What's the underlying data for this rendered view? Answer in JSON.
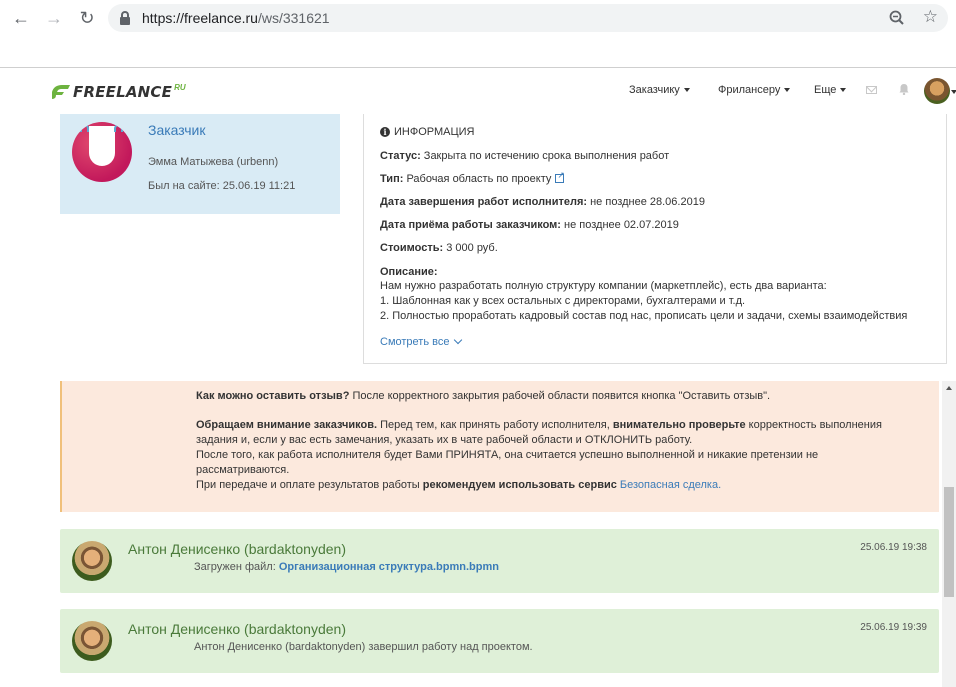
{
  "browser": {
    "url_host": "https://freelance.ru",
    "url_path": "/ws/331621"
  },
  "header": {
    "logo_text": "FREELANCE",
    "logo_suffix": "RU",
    "nav": [
      {
        "label": "Заказчику"
      },
      {
        "label": "Фрилансеру"
      },
      {
        "label": "Еще"
      }
    ]
  },
  "customer": {
    "role": "Заказчик",
    "name": "Эмма Матыжева (urbenn)",
    "last_seen": "Был на сайте: 25.06.19 11:21"
  },
  "info": {
    "title": "ИНФОРМАЦИЯ",
    "status_label": "Статус:",
    "status_value": "Закрыта по истечению срока выполнения работ",
    "type_label": "Тип:",
    "type_value": "Рабочая область по проекту",
    "deadline_label": "Дата завершения работ исполнителя:",
    "deadline_value": "не позднее 28.06.2019",
    "acceptance_label": "Дата приёма работы заказчиком:",
    "acceptance_value": "не позднее 02.07.2019",
    "cost_label": "Стоимость:",
    "cost_value": "3 000 руб.",
    "description_label": "Описание:",
    "description_lines": [
      "Нам нужно разработать полную структуру компании (маркетплейс), есть два варианта:",
      "1. Шаблонная как у всех остальных с директорами, бухгалтерами и т.д.",
      "2. Полностью проработать кадровый состав под нас, прописать цели и задачи, схемы взаимодействия"
    ],
    "see_all": "Смотреть все"
  },
  "notice": {
    "l1_bold": "Как можно оставить отзыв?",
    "l1_text": " После корректного закрытия рабочей области появится кнопка \"Оставить отзыв\".",
    "l2_bold": "Обращаем внимание заказчиков.",
    "l2_text": " Перед тем, как принять работу исполнителя, ",
    "l2_bold2": "внимательно проверьте",
    "l2_text2": " корректность выполнения",
    "l3": "задания и, если у вас есть замечания, указать их в чате рабочей области и ОТКЛОНИТЬ работу.",
    "l4": "После того, как работа исполнителя будет Вами ПРИНЯТА, она считается успешно выполненной и никакие претензии не",
    "l5": "рассматриваются.",
    "l6_text": "При передаче и оплате результатов работы ",
    "l6_bold": "рекомендуем использовать сервис",
    "l6_link": "Безопасная сделка."
  },
  "messages": [
    {
      "author": "Антон Денисенко (bardaktonyden)",
      "time": "25.06.19 19:38",
      "prefix": "Загружен файл: ",
      "link": "Организационная структура.bpmn.bpmn"
    },
    {
      "author": "Антон Денисенко (bardaktonyden)",
      "time": "25.06.19 19:39",
      "text": "Антон Денисенко (bardaktonyden) завершил работу над проектом."
    }
  ]
}
